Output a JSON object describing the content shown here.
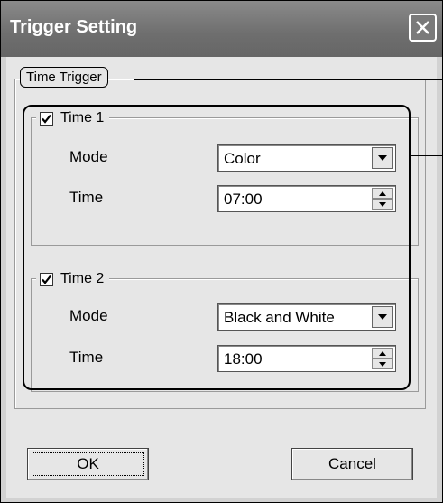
{
  "window": {
    "title": "Trigger Setting"
  },
  "group": {
    "label": "Time Trigger"
  },
  "time1": {
    "label": "Time 1",
    "checked": true,
    "mode_label": "Mode",
    "mode_value": "Color",
    "time_label": "Time",
    "time_value": "07:00"
  },
  "time2": {
    "label": "Time 2",
    "checked": true,
    "mode_label": "Mode",
    "mode_value": "Black and White",
    "time_label": "Time",
    "time_value": "18:00"
  },
  "buttons": {
    "ok": "OK",
    "cancel": "Cancel"
  },
  "icons": {
    "close": "close-icon",
    "check": "check-icon",
    "dropdown": "chevron-down-icon",
    "spin_up": "spin-up-icon",
    "spin_down": "spin-down-icon"
  }
}
